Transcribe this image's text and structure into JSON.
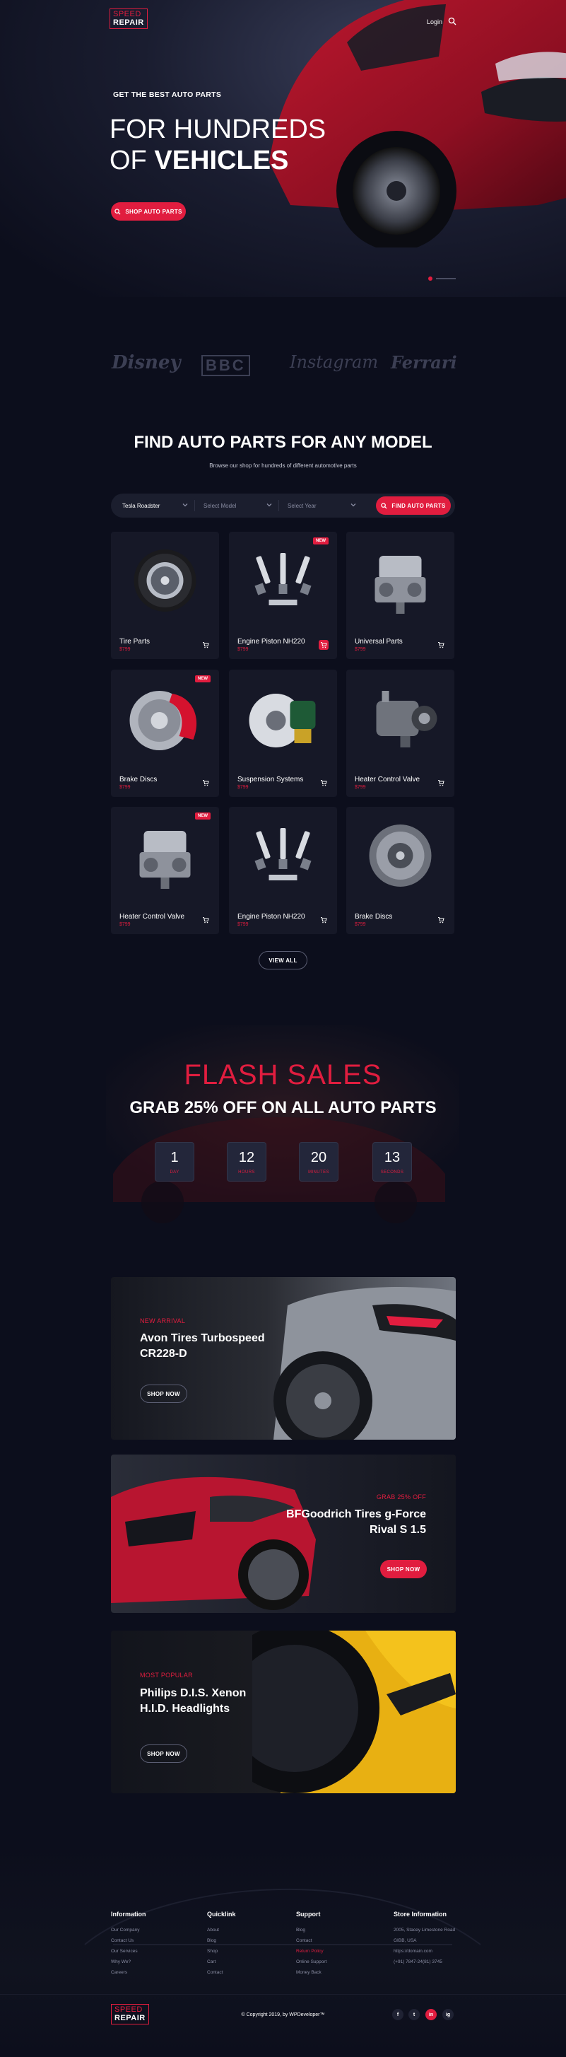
{
  "brand": {
    "line1": "SPEED",
    "line2": "REPAIR"
  },
  "header": {
    "login": "Login"
  },
  "hero": {
    "eyebrow": "GET THE BEST AUTO PARTS",
    "title_line1": "FOR HUNDREDS",
    "title_line2_prefix": "OF",
    "title_line2_bold": "VEHICLES",
    "cta": "SHOP AUTO PARTS"
  },
  "brands": [
    "Disney",
    "BBC",
    "Instagram",
    "Ferrari"
  ],
  "finder": {
    "title": "FIND AUTO PARTS FOR ANY MODEL",
    "subtitle": "Browse our shop for hundreds of different automotive parts",
    "select1": "Tesla Roadster",
    "select2": "Select Model",
    "select3": "Select Year",
    "button": "FIND AUTO PARTS"
  },
  "products": [
    {
      "name": "Tire Parts",
      "price": "$799",
      "new": false,
      "cart_active": false,
      "icon": "tire-icon"
    },
    {
      "name": "Engine Piston NH220",
      "price": "$799",
      "new": true,
      "cart_active": true,
      "icon": "spark-plugs-icon"
    },
    {
      "name": "Universal Parts",
      "price": "$799",
      "new": false,
      "cart_active": false,
      "icon": "engine-part-icon"
    },
    {
      "name": "Brake Discs",
      "price": "$799",
      "new": true,
      "cart_active": false,
      "icon": "brake-disc-icon"
    },
    {
      "name": "Suspension Systems",
      "price": "$799",
      "new": false,
      "cart_active": false,
      "icon": "suspension-icon"
    },
    {
      "name": "Heater Control Valve",
      "price": "$799",
      "new": false,
      "cart_active": false,
      "icon": "compressor-icon"
    },
    {
      "name": "Heater Control Valve",
      "price": "$799",
      "new": true,
      "cart_active": false,
      "icon": "engine-part-icon"
    },
    {
      "name": "Engine Piston NH220",
      "price": "$799",
      "new": false,
      "cart_active": false,
      "icon": "spark-plugs-icon"
    },
    {
      "name": "Brake Discs",
      "price": "$799",
      "new": false,
      "cart_active": false,
      "icon": "clutch-icon"
    }
  ],
  "new_label": "NEW",
  "view_all": "VIEW ALL",
  "flash": {
    "title": "FLASH SALES",
    "subtitle": "GRAB 25% OFF ON ALL AUTO PARTS",
    "countdown": [
      {
        "value": "1",
        "unit": "DAY"
      },
      {
        "value": "12",
        "unit": "HOURS"
      },
      {
        "value": "20",
        "unit": "MINUTES"
      },
      {
        "value": "13",
        "unit": "SECONDS"
      }
    ]
  },
  "banners": [
    {
      "tag": "NEW ARRIVAL",
      "title_l1": "Avon Tires Turbospeed",
      "title_l2": "CR228-D",
      "button": "SHOP NOW"
    },
    {
      "tag": "GRAB 25% OFF",
      "title_l1": "BFGoodrich Tires g-Force",
      "title_l2": "Rival S 1.5",
      "button": "SHOP NOW"
    },
    {
      "tag": "MOST POPULAR",
      "title_l1": "Philips D.I.S. Xenon",
      "title_l2": "H.I.D. Headlights",
      "button": "SHOP NOW"
    }
  ],
  "footer": {
    "columns": [
      {
        "heading": "Information",
        "links": [
          "Our Company",
          "Contact Us",
          "Our Services",
          "Why We?",
          "Careers"
        ]
      },
      {
        "heading": "Quicklink",
        "links": [
          "About",
          "Blog",
          "Shop",
          "Cart",
          "Contact"
        ]
      },
      {
        "heading": "Support",
        "links": [
          "Blog",
          "Contact",
          "Return Policy",
          "Online Support",
          "Money Back"
        ]
      },
      {
        "heading": "Store Information",
        "links": [
          "2005, Stacey Limestone Road",
          "GIBB, USA",
          "https://domain.com",
          "(+91) 7847-24(81) 3745"
        ]
      }
    ],
    "copyright": "© Copyright 2019, by WPDeveloper™",
    "social": [
      "f",
      "t",
      "in",
      "ig"
    ]
  },
  "colors": {
    "accent": "#e11d3f",
    "background": "#0c0e1c",
    "card": "#161827"
  }
}
